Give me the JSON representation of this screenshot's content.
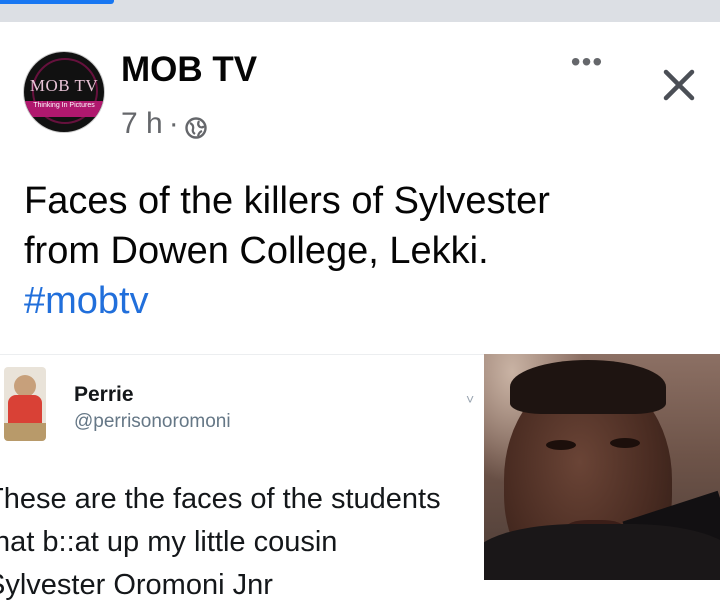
{
  "post": {
    "page_name": "MOB TV",
    "avatar_logo_text": "MOB TV",
    "avatar_tagline": "Thinking In Pictures",
    "time_ago": "7 h",
    "meta_separator": "·",
    "privacy_icon": "globe-icon",
    "more_label": "•••",
    "close_icon": "close-icon",
    "text_lines": [
      "Faces of the killers of Sylvester",
      "from Dowen College, Lekki."
    ],
    "hashtag": "#mobtv"
  },
  "tweet": {
    "name": "Perrie",
    "handle": "@perrisonoromoni",
    "caret": "˅",
    "body_lines": [
      "These are the faces of the students",
      "that b::at up my little cousin",
      "Sylvester Oromoni Jnr"
    ]
  },
  "colors": {
    "hashtag": "#216fdb",
    "top_bar": "#dcdfe4",
    "accent": "#1877f2",
    "meta_text": "#65676b"
  }
}
